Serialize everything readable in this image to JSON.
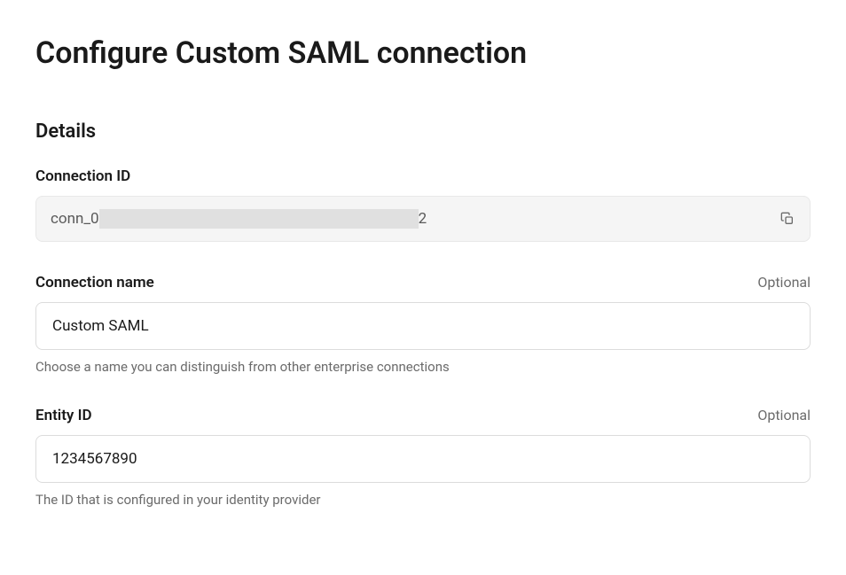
{
  "page": {
    "title": "Configure Custom SAML connection"
  },
  "details": {
    "section_title": "Details",
    "connection_id": {
      "label": "Connection ID",
      "prefix": "conn_0",
      "suffix": "2"
    },
    "connection_name": {
      "label": "Connection name",
      "optional_label": "Optional",
      "value": "Custom SAML",
      "help": "Choose a name you can distinguish from other enterprise connections"
    },
    "entity_id": {
      "label": "Entity ID",
      "optional_label": "Optional",
      "value": "1234567890",
      "help": "The ID that is configured in your identity provider"
    }
  }
}
